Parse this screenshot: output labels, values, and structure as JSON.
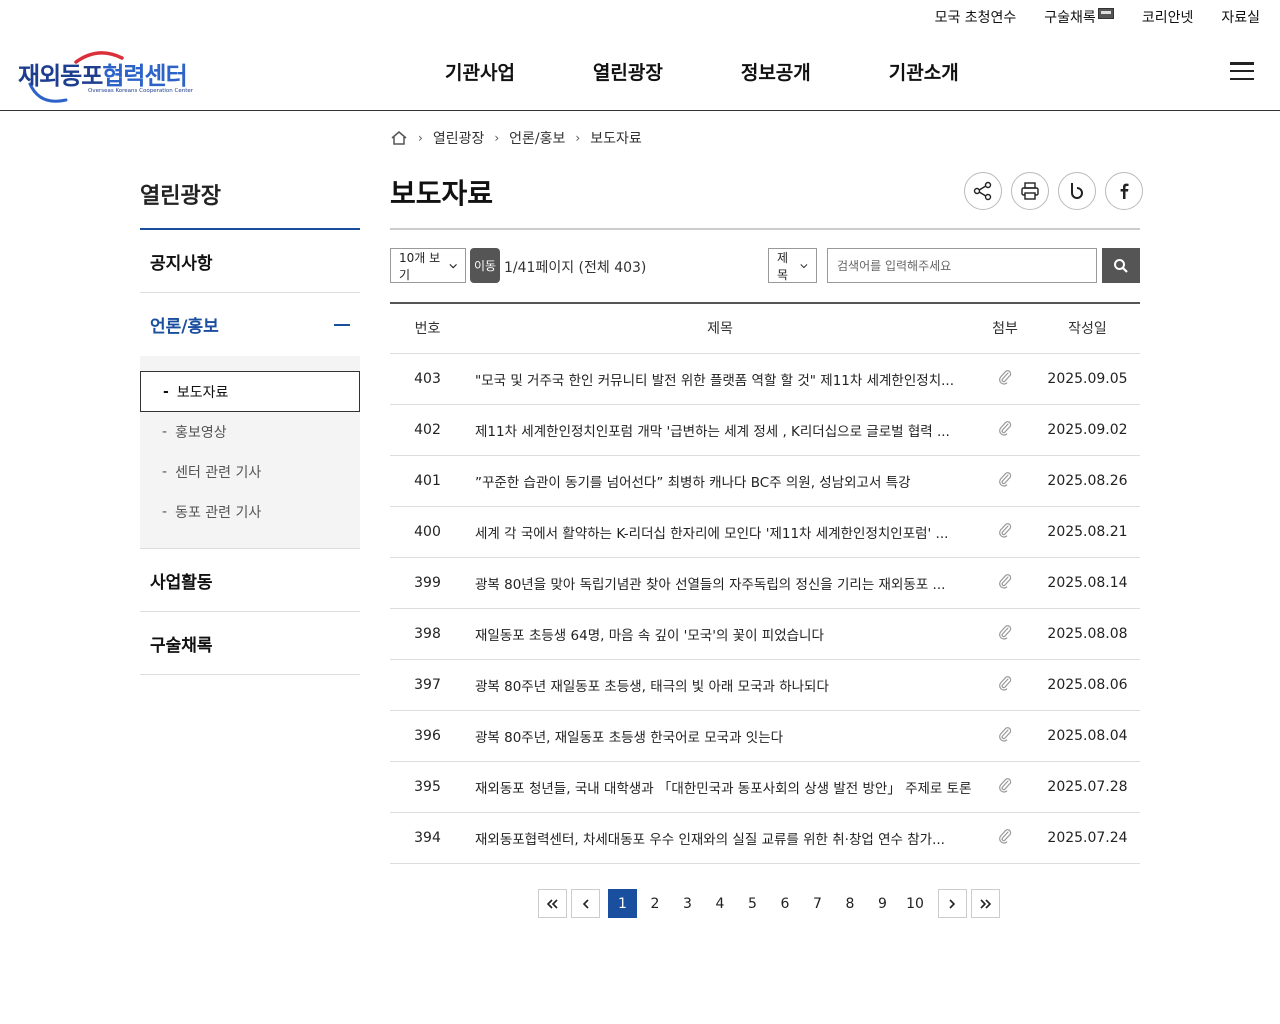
{
  "util_links": [
    {
      "label": "모국 초청연수"
    },
    {
      "label": "구술채록"
    },
    {
      "label": "코리안넷"
    },
    {
      "label": "자료실"
    }
  ],
  "logo": {
    "kr_main": "재외동포",
    "kr_sub": "협력센터",
    "en": "Overseas Koreans Cooperation Center"
  },
  "gnb": [
    {
      "label": "기관사업"
    },
    {
      "label": "열린광장"
    },
    {
      "label": "정보공개"
    },
    {
      "label": "기관소개"
    }
  ],
  "sidebar": {
    "title": "열린광장",
    "items": [
      {
        "label": "공지사항"
      },
      {
        "label": "언론/홍보"
      },
      {
        "label": "사업활동"
      },
      {
        "label": "구술채록"
      }
    ],
    "sub_items": [
      {
        "label": "보도자료"
      },
      {
        "label": "홍보영상"
      },
      {
        "label": "센터 관련 기사"
      },
      {
        "label": "동포 관련 기사"
      }
    ]
  },
  "breadcrumb": {
    "level1": "열린광장",
    "level2": "언론/홍보",
    "level3": "보도자료"
  },
  "page_title": "보도자료",
  "toolbar": {
    "per_page": "10개 보기",
    "go_label": "이동",
    "page_info": "1/41페이지 (전체 403)",
    "search_field": "제목",
    "search_placeholder": "검색어를 입력해주세요"
  },
  "table": {
    "headers": {
      "no": "번호",
      "subject": "제목",
      "attach": "첨부",
      "date": "작성일"
    },
    "rows": [
      {
        "no": "403",
        "subject": "\"모국 및 거주국 한인 커뮤니티 발전 위한 플랫폼 역할 할 것\" 제11차 세계한인정치...",
        "date": "2025.09.05"
      },
      {
        "no": "402",
        "subject": "제11차 세계한인정치인포럼 개막 '급변하는 세계 정세 , K리더십으로 글로벌 협력 ...",
        "date": "2025.09.02"
      },
      {
        "no": "401",
        "subject": "”꾸준한 습관이 동기를 넘어선다” 최병하 캐나다 BC주 의원, 성남외고서 특강",
        "date": "2025.08.26"
      },
      {
        "no": "400",
        "subject": "세계 각 국에서 활약하는 K-리더십 한자리에 모인다 '제11차 세계한인정치인포럼' ...",
        "date": "2025.08.21"
      },
      {
        "no": "399",
        "subject": "광복 80년을 맞아 독립기념관 찾아 선열들의 자주독립의 정신을 기리는 재외동포 ...",
        "date": "2025.08.14"
      },
      {
        "no": "398",
        "subject": "재일동포 초등생 64명, 마음 속 깊이 '모국'의 꽃이 피었습니다",
        "date": "2025.08.08"
      },
      {
        "no": "397",
        "subject": "광복 80주년 재일동포 초등생, 태극의 빛 아래 모국과 하나되다",
        "date": "2025.08.06"
      },
      {
        "no": "396",
        "subject": "광복 80주년, 재일동포 초등생 한국어로 모국과 잇는다",
        "date": "2025.08.04"
      },
      {
        "no": "395",
        "subject": "재외동포 청년들, 국내 대학생과 「대한민국과 동포사회의 상생 발전 방안」 주제로 토론",
        "date": "2025.07.28"
      },
      {
        "no": "394",
        "subject": "재외동포협력센터, 차세대동포 우수 인재와의 실질 교류를 위한 취·창업 연수 참가...",
        "date": "2025.07.24"
      }
    ]
  },
  "pagination": {
    "current": "1",
    "pages": [
      "1",
      "2",
      "3",
      "4",
      "5",
      "6",
      "7",
      "8",
      "9",
      "10"
    ]
  },
  "colors": {
    "accent": "#1a4fa0",
    "button_dark": "#555555"
  }
}
